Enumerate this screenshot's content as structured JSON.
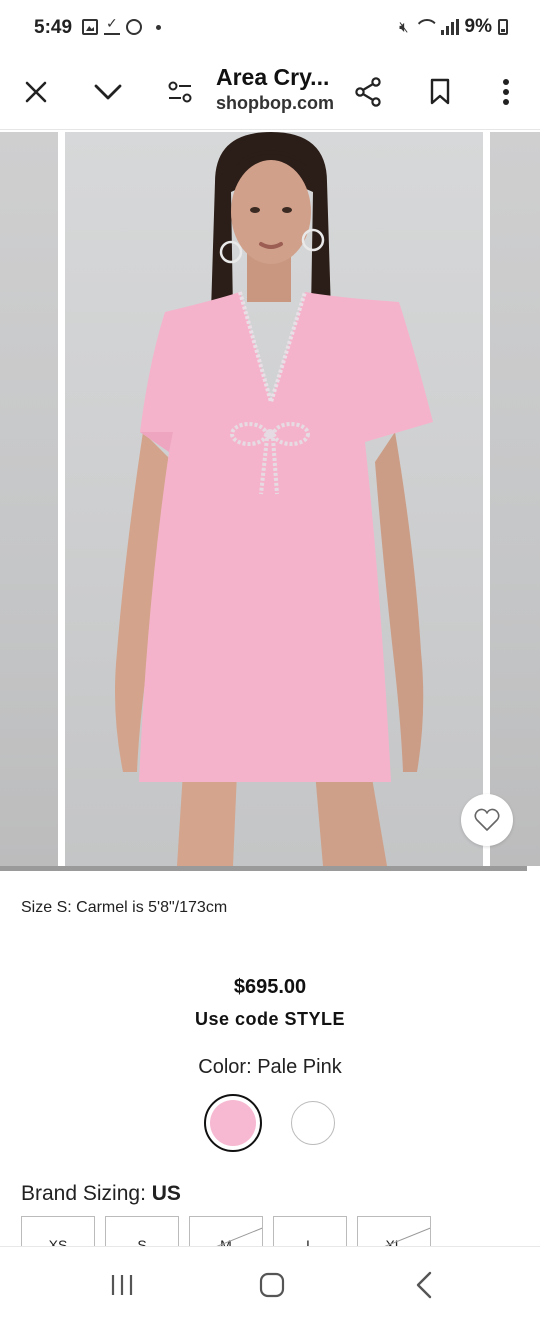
{
  "status_bar": {
    "time": "5:49",
    "battery": "9%",
    "icons": [
      "gallery-icon",
      "download-done-icon",
      "whatsapp-icon",
      "dot-icon",
      "mute-icon",
      "wifi-icon",
      "signal-icon",
      "battery-icon"
    ]
  },
  "toolbar": {
    "title": "Area Cry...",
    "url": "shopbop.com",
    "icons": [
      "close-icon",
      "chevron-down-icon",
      "tune-icon",
      "share-icon",
      "bookmark-icon",
      "more-vert-icon"
    ]
  },
  "gallery": {
    "description": "",
    "progress": 0.98
  },
  "product": {
    "model_info": "Size S: Carmel is 5'8\"/173cm",
    "price": "$695.00",
    "promo": "Use code STYLE",
    "color_label": "Color: Pale Pink",
    "swatches": [
      {
        "color": "#f6b9d1",
        "selected": true
      },
      {
        "color": "#ffffff",
        "selected": false
      }
    ],
    "sizing_label": "Brand Sizing: ",
    "sizing_value": "US",
    "sizes": [
      "XS",
      "S",
      "M",
      "L",
      "XL"
    ]
  },
  "colors": {
    "dress_pink": "#f5b3cb",
    "background": "#cfd0d1"
  },
  "nav": {
    "icons": [
      "recents-icon",
      "home-icon",
      "back-icon"
    ]
  }
}
